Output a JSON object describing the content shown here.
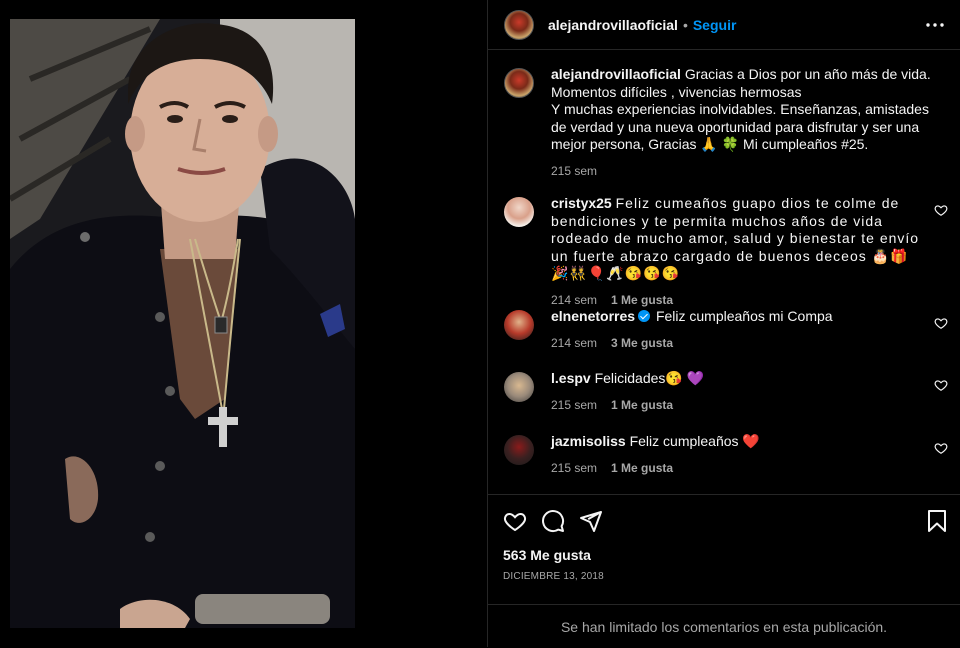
{
  "post": {
    "author": "alejandrovillaoficial",
    "follow_label": "Seguir",
    "caption_lines": [
      "Gracias a Dios por un año más de vida.",
      "Momentos difíciles , vivencias hermosas",
      "Y muchas experiencias inolvidables. Enseñanzas, amistades de verdad y una nueva oportunidad para disfrutar y ser una mejor persona, Gracias 🙏 🍀  Mi cumpleaños #25."
    ],
    "caption_time": "215 sem",
    "likes": "563 Me gusta",
    "date": "DICIEMBRE 13, 2018",
    "comments_limited": "Se han limitado los comentarios en esta publicación."
  },
  "comments": [
    {
      "user": "cristyx25",
      "text": "Feliz cumeaños guapo dios te colme de bendiciones y te permita muchos años de vida rodeado de mucho amor, salud y bienestar te envío un fuerte abrazo cargado de buenos deceos 🎂🎁🎉👯🎈🥂😘😘😘",
      "time": "214 sem",
      "likes": "1 Me gusta"
    },
    {
      "user": "elnenetorres",
      "text": "Feliz cumpleaños mi Compa",
      "time": "214 sem",
      "likes": "3 Me gusta"
    },
    {
      "user": "l.espv",
      "text": "Felicidades😘 💜",
      "time": "215 sem",
      "likes": "1 Me gusta"
    },
    {
      "user": "jazmisoliss",
      "text": "Feliz cumpleaños ❤️",
      "time": "215 sem",
      "likes": "1 Me gusta"
    }
  ],
  "colors": {
    "background": "#000000",
    "accent_blue": "#0095f6",
    "muted_text": "#a8a8a8",
    "divider": "#262626"
  },
  "icons": [
    "more-icon",
    "heart-icon",
    "comment-icon",
    "share-icon",
    "save-icon",
    "verified-icon"
  ]
}
